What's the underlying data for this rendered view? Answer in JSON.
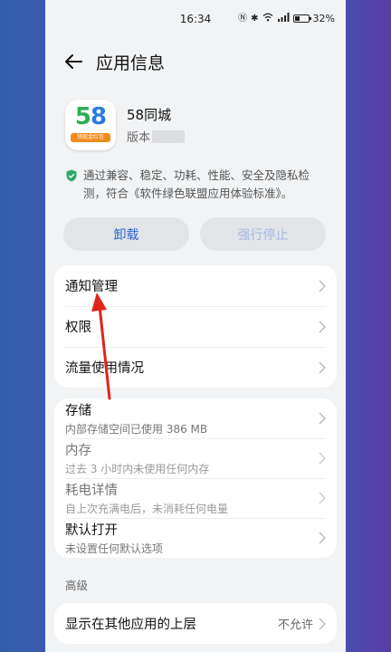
{
  "status": {
    "time": "16:34",
    "battery": "32%",
    "icons": [
      "nfc-icon",
      "bluetooth-icon",
      "wifi-icon",
      "signal-icon",
      "battery-icon"
    ]
  },
  "header": {
    "title": "应用信息"
  },
  "app": {
    "name": "58同城",
    "version_prefix": "版本",
    "icon_text": "58",
    "icon_strip": "领现金红包"
  },
  "notice": "通过兼容、稳定、功耗、性能、安全及隐私检测，符合《软件绿色联盟应用体验标准》。",
  "buttons": {
    "uninstall": "卸载",
    "force_stop": "强行停止"
  },
  "card1": [
    {
      "label": "通知管理"
    },
    {
      "label": "权限"
    },
    {
      "label": "流量使用情况"
    }
  ],
  "card2": [
    {
      "label": "存储",
      "sub": "内部存储空间已使用 386 MB"
    },
    {
      "label": "内存",
      "sub": "过去 3 小时内未使用任何内存"
    },
    {
      "label": "耗电详情",
      "sub": "自上次充满电后，未消耗任何电量"
    },
    {
      "label": "默认打开",
      "sub": "未设置任何默认选项"
    }
  ],
  "advanced": {
    "section_title": "高级",
    "items": [
      {
        "label": "显示在其他应用的上层",
        "value": "不允许"
      }
    ]
  },
  "colors": {
    "accent": "#2a63d4",
    "annotation_arrow": "#e0251b"
  }
}
